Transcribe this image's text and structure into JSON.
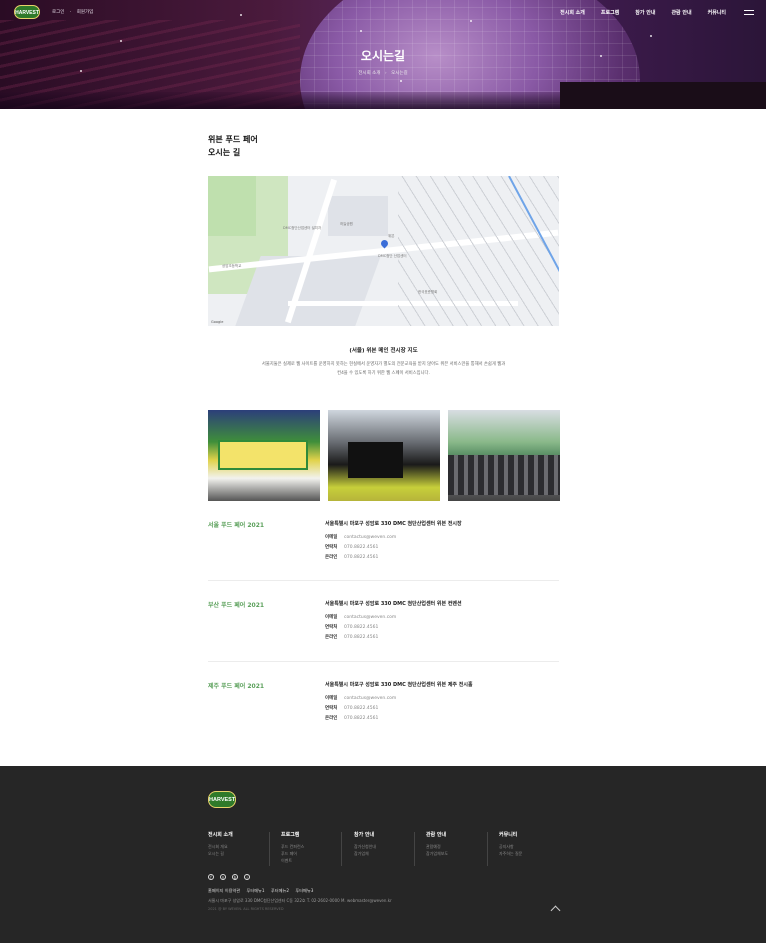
{
  "header": {
    "logo_text": "HARVEST",
    "top_links": [
      "로그인",
      "회원가입"
    ],
    "nav": [
      "전시회 소개",
      "프로그램",
      "참가 안내",
      "관람 안내",
      "커뮤니티"
    ]
  },
  "hero": {
    "title": "오시는길",
    "breadcrumb": [
      "전시회 소개",
      "오시는길"
    ]
  },
  "section": {
    "title_line1": "위븐 푸드 페어",
    "title_line2": "오시는 길"
  },
  "map": {
    "labels": [
      "DMC첨단산업센터 설치자",
      "하늘공원",
      "위븐",
      "DMC첨단 산업센터",
      "상암초등학교",
      "한국표준협회"
    ],
    "attribution": "Google"
  },
  "map_caption": {
    "title": "(서울) 위븐 메인 전시장 지도",
    "desc_line1": "서울지둘은 실제로 웹 사이트를 운영하지 못하는 현실에서 운영자가 별도의 전문교육을 받지 않아도 위븐 서비스만을 통해서 손쉽게 웹과",
    "desc_line2": "컨4을 수 있도록 하기 위한 웹 스페이 서비스입니다."
  },
  "venues": [
    {
      "name": "서울 푸드 페어 2021",
      "address": "서울특별시 마포구 성암로 330 DMC 첨단산업센터 위븐 전시장",
      "email_label": "이메일",
      "email": "contactus@weven.com",
      "phone_label": "연락처",
      "phone": "070.8822.4561",
      "online_label": "온라인",
      "online": "070.8822.4561"
    },
    {
      "name": "부산 푸드 페어 2021",
      "address": "서울특별시 마포구 성암로 330 DMC 첨단산업센터 위븐 컨벤션",
      "email_label": "이메일",
      "email": "contactus@weven.com",
      "phone_label": "연락처",
      "phone": "070.8822.4561",
      "online_label": "온라인",
      "online": "070.8822.4561"
    },
    {
      "name": "제주 푸드 페어 2021",
      "address": "서울특별시 마포구 성암로 330 DMC 첨단산업센터 위븐 제주 전시홀",
      "email_label": "이메일",
      "email": "contactus@weven.com",
      "phone_label": "연락처",
      "phone": "070.8822.4561",
      "online_label": "온라인",
      "online": "070.8822.4561"
    }
  ],
  "footer": {
    "logo_text": "HARVEST",
    "columns": [
      {
        "title": "전시회 소개",
        "items": [
          "전시회 개요",
          "오시는 길"
        ]
      },
      {
        "title": "프로그램",
        "items": [
          "푸드 컨퍼런스",
          "푸드 페어",
          "이벤트"
        ]
      },
      {
        "title": "참가 안내",
        "items": [
          "참가신청안내",
          "참가업체"
        ]
      },
      {
        "title": "관람 안내",
        "items": [
          "관람예정",
          "참가업체보도"
        ]
      },
      {
        "title": "커뮤니티",
        "items": [
          "공지사항",
          "자주하는 질문"
        ]
      }
    ],
    "social": [
      "f",
      "n",
      "b",
      "i"
    ],
    "links": [
      "홈페이지 이용약관",
      "푸터메뉴1",
      "푸터메뉴2",
      "푸터메뉴3"
    ],
    "address": "서울시 마포구 성암로 330 DMC첨단산업센터 C동 322호   T. 02-2602-0000   M. webmaster@weven.kr",
    "copyright": "2021 @ BY WEVEN. ALL RIGHTS RESERVED"
  }
}
